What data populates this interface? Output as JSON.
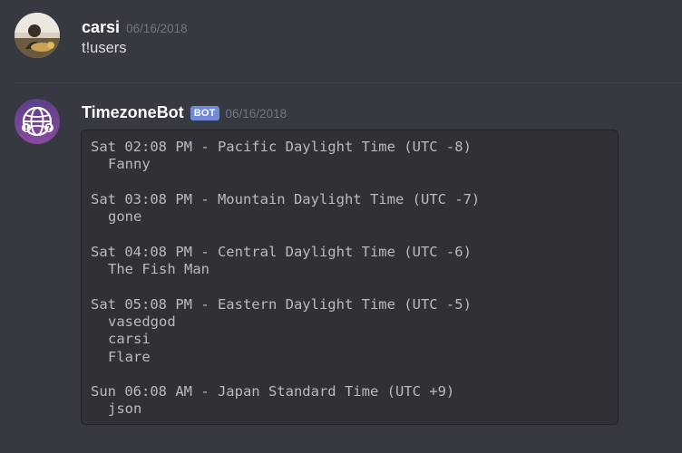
{
  "messages": [
    {
      "username": "carsi",
      "timestamp": "06/16/2018",
      "content": "t!users",
      "avatar_icon": "photo-avatar"
    },
    {
      "username": "TimezoneBot",
      "bot_tag": "BOT",
      "timestamp": "06/16/2018",
      "avatar_icon": "globe-avatar",
      "codeblock": {
        "groups": [
          {
            "header": "Sat 02:08 PM - Pacific Daylight Time (UTC -8)",
            "users": [
              "Fanny"
            ]
          },
          {
            "header": "Sat 03:08 PM - Mountain Daylight Time (UTC -7)",
            "users": [
              "gone"
            ]
          },
          {
            "header": "Sat 04:08 PM - Central Daylight Time (UTC -6)",
            "users": [
              "The Fish Man"
            ]
          },
          {
            "header": "Sat 05:08 PM - Eastern Daylight Time (UTC -5)",
            "users": [
              "vasedgod",
              "carsi",
              "Flare"
            ]
          },
          {
            "header": "Sun 06:08 AM - Japan Standard Time (UTC +9)",
            "users": [
              "json"
            ]
          }
        ]
      }
    }
  ],
  "colors": {
    "background": "#36393f",
    "codeblock_bg": "#2f3136",
    "bot_tag": "#7289da",
    "timestamp": "#72767d",
    "text": "#dcddde"
  }
}
